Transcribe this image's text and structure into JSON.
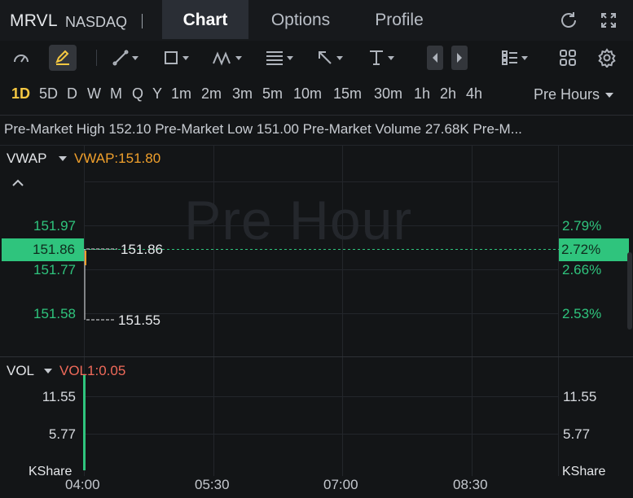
{
  "header": {
    "symbol": "MRVL",
    "exchange": "NASDAQ",
    "tabs": [
      {
        "label": "Chart",
        "active": true
      },
      {
        "label": "Options",
        "active": false
      },
      {
        "label": "Profile",
        "active": false
      }
    ],
    "icons": [
      "refresh-icon",
      "fullscreen-icon"
    ]
  },
  "toolbar": {
    "icons": [
      "gauge-icon",
      "draw-pen-icon",
      "line-tool-icon",
      "rectangle-tool-icon",
      "pattern-tool-icon",
      "fibonacci-tool-icon",
      "arrow-tool-icon",
      "text-tool-icon",
      "prev-icon",
      "next-icon",
      "layout-icon",
      "grid-icon",
      "settings-icon"
    ]
  },
  "intervals": [
    "1D",
    "5D",
    "D",
    "W",
    "M",
    "Q",
    "Y",
    "1m",
    "2m",
    "3m",
    "5m",
    "10m",
    "15m",
    "30m",
    "1h",
    "2h",
    "4h"
  ],
  "active_interval": "1D",
  "session_select": "Pre Hours",
  "info_bar": "Pre-Market High 152.10 Pre-Market Low 151.00 Pre-Market Volume 27.68K Pre-M...",
  "main_pane": {
    "indicator": "VWAP",
    "indicator_value": "VWAP:151.80",
    "watermark": "Pre Hour",
    "price_labels": [
      "151.97",
      "151.77",
      "151.58"
    ],
    "percent_labels": [
      "2.79%",
      "2.66%",
      "2.53%"
    ],
    "current_price": "151.86",
    "current_percent": "2.72%",
    "high_marker": "151.86",
    "low_marker": "151.55"
  },
  "volume_pane": {
    "indicator": "VOL",
    "indicator_value": "VOL1:0.05",
    "labels": [
      "11.55",
      "5.77"
    ],
    "unit": "KShare"
  },
  "time_axis": [
    "04:00",
    "05:30",
    "07:00",
    "08:30"
  ],
  "colors": {
    "background": "#131517",
    "up": "#2fc47d",
    "vwap": "#f0a02c",
    "vol": "#f06a5a",
    "active_interval": "#f5c842"
  }
}
